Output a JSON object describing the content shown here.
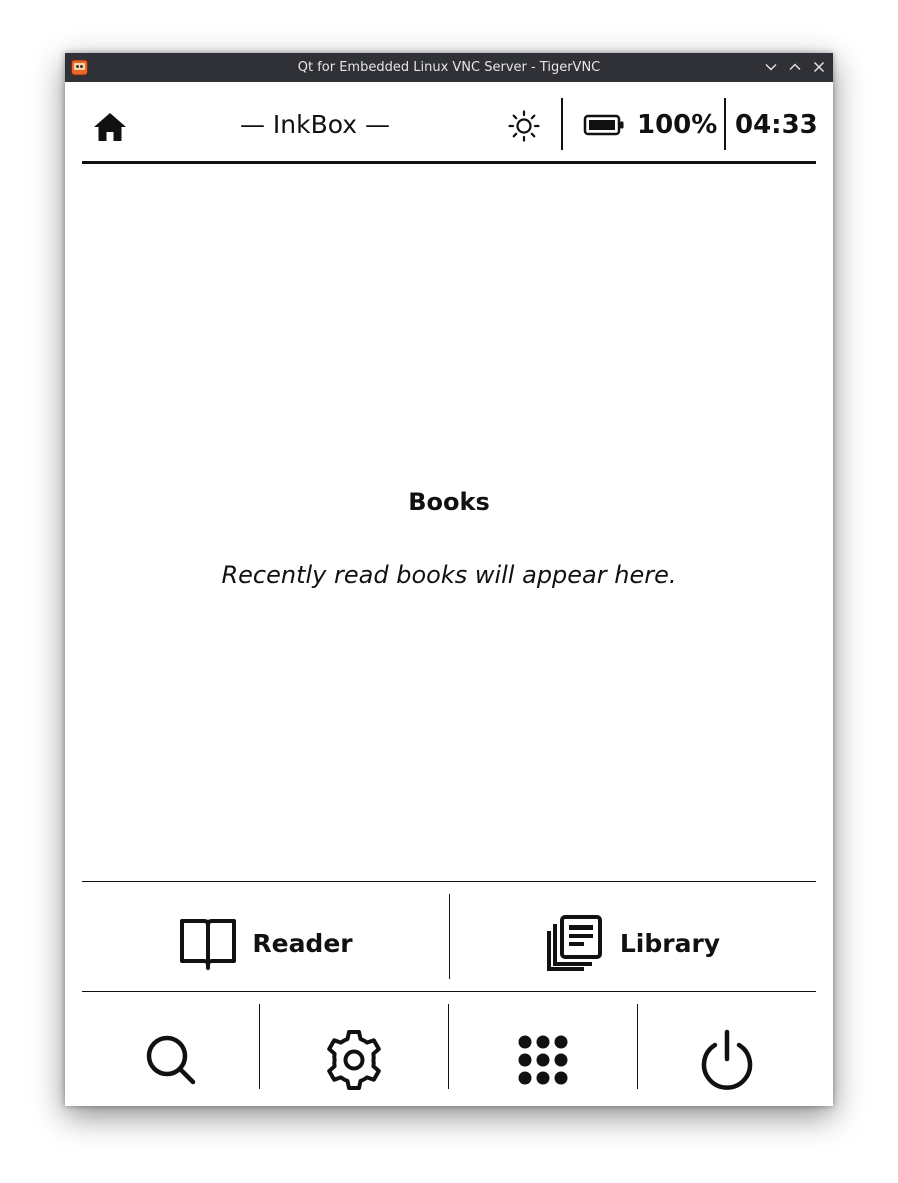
{
  "window": {
    "title": "Qt for Embedded Linux VNC Server - TigerVNC"
  },
  "topbar": {
    "home_icon": "home-icon",
    "app_title": "— InkBox —",
    "brightness_icon": "sun-icon",
    "battery_icon": "battery-full-icon",
    "battery_percent": "100%",
    "time": "04:33"
  },
  "main": {
    "section_title": "Books",
    "empty_message": "Recently read books will appear here."
  },
  "actions": {
    "reader_label": "Reader",
    "reader_icon": "open-book-icon",
    "library_label": "Library",
    "library_icon": "library-icon"
  },
  "toolbar": [
    {
      "icon": "search-icon"
    },
    {
      "icon": "gear-icon"
    },
    {
      "icon": "apps-grid-icon"
    },
    {
      "icon": "power-icon"
    }
  ],
  "colors": {
    "titlebar_bg": "#2f3136",
    "foreground": "#111111",
    "background": "#ffffff"
  }
}
